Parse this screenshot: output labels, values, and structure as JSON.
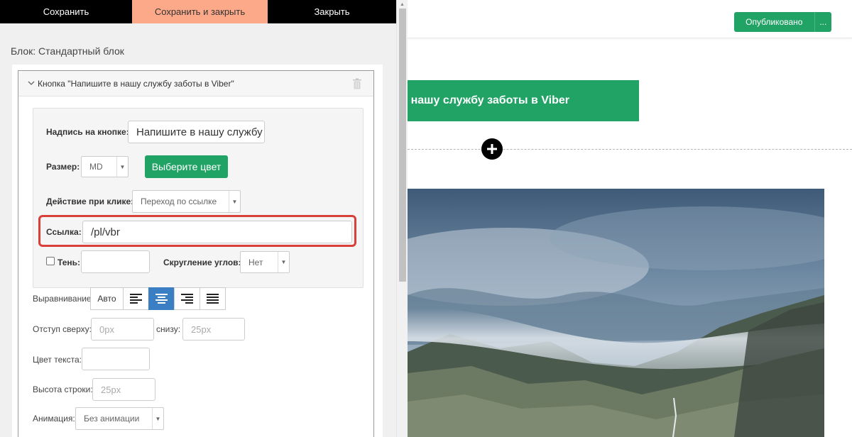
{
  "toolbar": {
    "save_label": "Сохранить",
    "save_close_label": "Сохранить и закрыть",
    "close_label": "Закрыть"
  },
  "editor": {
    "block_title": "Блок: Стандартный блок",
    "card_title": "Кнопка \"Напишите в нашу службу заботы в Viber\"",
    "button_text_label": "Надпись на кнопке:",
    "button_text_value": "Напишите в нашу службу заботы в Viber",
    "size_label": "Размер:",
    "size_value": "MD",
    "choose_color_label": "Выберите цвет",
    "click_action_label": "Действие при клике:",
    "click_action_value": "Переход по ссылке",
    "link_label": "Ссылка:",
    "link_value": "/pl/vbr",
    "shadow_label": "Тень:",
    "shadow_value": "",
    "rounding_label": "Скругление углов:",
    "rounding_value": "Нет",
    "align_label": "Выравнивание",
    "align_auto_label": "Авто",
    "align_selected": "center",
    "padding_top_label": "Отступ сверху:",
    "padding_top_placeholder": "0px",
    "padding_bottom_label": "снизу:",
    "padding_bottom_placeholder": "25px",
    "text_color_label": "Цвет текста:",
    "text_color_value": "",
    "line_height_label": "Высота строки:",
    "line_height_placeholder": "25px",
    "animation_label": "Анимация:",
    "animation_value": "Без анимации"
  },
  "preview": {
    "published_label": "Опубликовано",
    "more_label": "...",
    "button_text": "Напишите в нашу службу заботы в Viber"
  },
  "colors": {
    "accent_green": "#21a366",
    "save_close_bg": "#fba989",
    "toolbar_bg": "#000000",
    "active_align": "#3a7fc4",
    "highlight_border": "#d9403a"
  }
}
